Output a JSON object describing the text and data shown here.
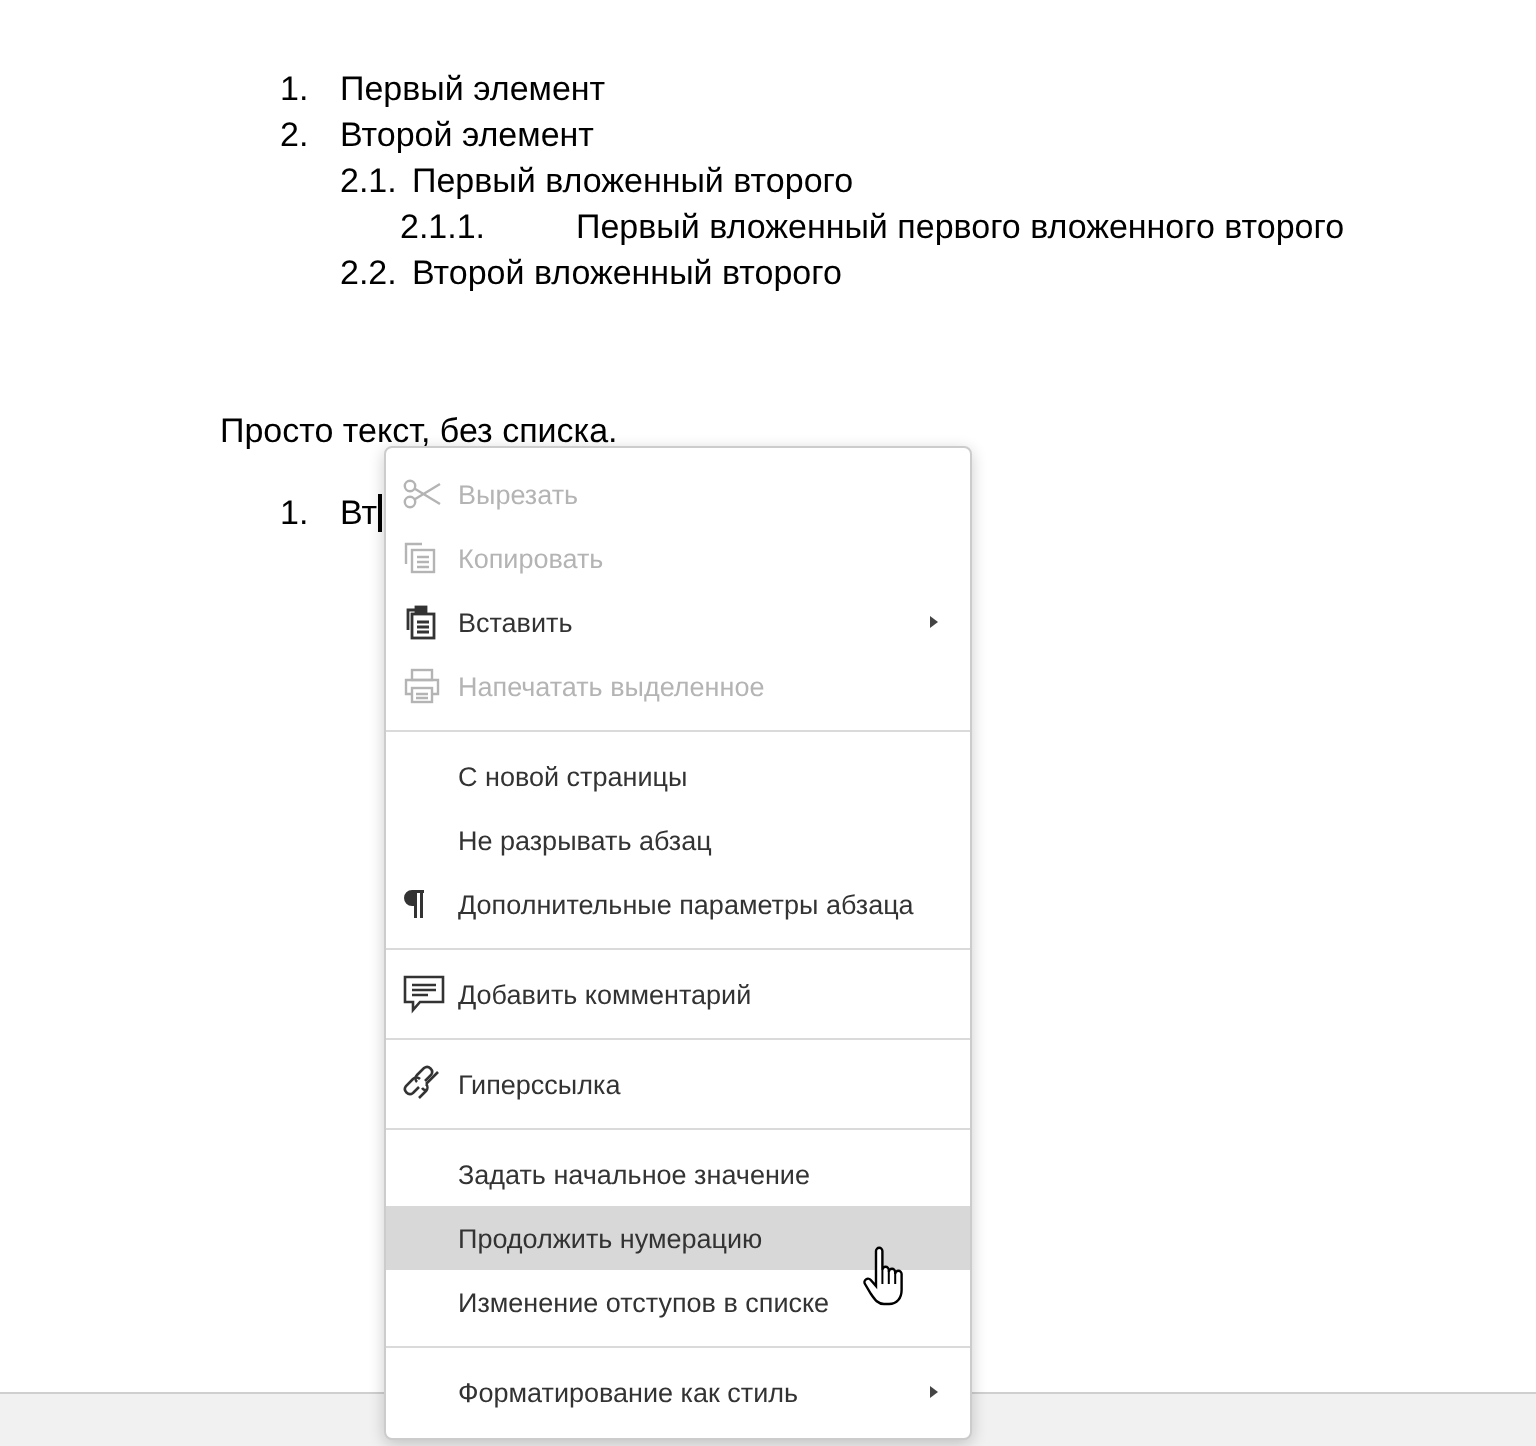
{
  "document": {
    "list": [
      {
        "number": "1.",
        "text": "Первый элемент"
      },
      {
        "number": "2.",
        "text": "Второй элемент",
        "children": [
          {
            "number": "2.1.",
            "text": "Первый вложенный второго",
            "children": [
              {
                "number": "2.1.1.",
                "text": "Первый вложенный первого вложенного второго"
              }
            ]
          },
          {
            "number": "2.2.",
            "text": "Второй вложенный второго"
          }
        ]
      }
    ],
    "paragraph": "Просто текст, без списка.",
    "second_list": [
      {
        "number": "1.",
        "text": "Вт"
      }
    ]
  },
  "context_menu": {
    "groups": [
      {
        "items": [
          {
            "label": "Вырезать",
            "disabled": true,
            "selected": false,
            "submenu": false
          },
          {
            "label": "Копировать",
            "disabled": true,
            "selected": false,
            "submenu": false
          },
          {
            "label": "Вставить",
            "disabled": false,
            "selected": false,
            "submenu": true
          },
          {
            "label": "Напечатать выделенное",
            "disabled": true,
            "selected": false,
            "submenu": false
          }
        ]
      },
      {
        "items": [
          {
            "label": "С новой страницы",
            "disabled": false,
            "selected": false,
            "submenu": false
          },
          {
            "label": "Не разрывать абзац",
            "disabled": false,
            "selected": false,
            "submenu": false
          },
          {
            "label": "Дополнительные параметры абзаца",
            "disabled": false,
            "selected": false,
            "submenu": false
          }
        ]
      },
      {
        "items": [
          {
            "label": "Добавить комментарий",
            "disabled": false,
            "selected": false,
            "submenu": false
          }
        ]
      },
      {
        "items": [
          {
            "label": "Гиперссылка",
            "disabled": false,
            "selected": false,
            "submenu": false
          }
        ]
      },
      {
        "items": [
          {
            "label": "Задать начальное значение",
            "disabled": false,
            "selected": false,
            "submenu": false
          },
          {
            "label": "Продолжить нумерацию",
            "disabled": false,
            "selected": true,
            "submenu": false
          },
          {
            "label": "Изменение отступов в списке",
            "disabled": false,
            "selected": false,
            "submenu": false
          }
        ]
      },
      {
        "items": [
          {
            "label": "Форматирование как стиль",
            "disabled": false,
            "selected": false,
            "submenu": true
          }
        ]
      }
    ]
  }
}
